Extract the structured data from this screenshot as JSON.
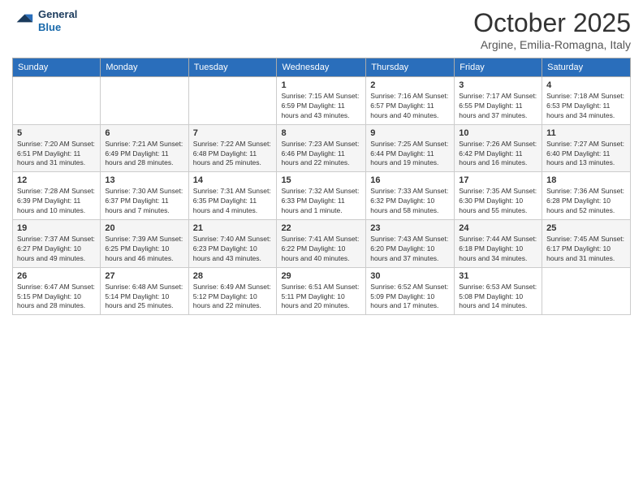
{
  "logo": {
    "line1": "General",
    "line2": "Blue"
  },
  "title": "October 2025",
  "subtitle": "Argine, Emilia-Romagna, Italy",
  "days_of_week": [
    "Sunday",
    "Monday",
    "Tuesday",
    "Wednesday",
    "Thursday",
    "Friday",
    "Saturday"
  ],
  "weeks": [
    [
      {
        "day": "",
        "info": ""
      },
      {
        "day": "",
        "info": ""
      },
      {
        "day": "",
        "info": ""
      },
      {
        "day": "1",
        "info": "Sunrise: 7:15 AM\nSunset: 6:59 PM\nDaylight: 11 hours\nand 43 minutes."
      },
      {
        "day": "2",
        "info": "Sunrise: 7:16 AM\nSunset: 6:57 PM\nDaylight: 11 hours\nand 40 minutes."
      },
      {
        "day": "3",
        "info": "Sunrise: 7:17 AM\nSunset: 6:55 PM\nDaylight: 11 hours\nand 37 minutes."
      },
      {
        "day": "4",
        "info": "Sunrise: 7:18 AM\nSunset: 6:53 PM\nDaylight: 11 hours\nand 34 minutes."
      }
    ],
    [
      {
        "day": "5",
        "info": "Sunrise: 7:20 AM\nSunset: 6:51 PM\nDaylight: 11 hours\nand 31 minutes."
      },
      {
        "day": "6",
        "info": "Sunrise: 7:21 AM\nSunset: 6:49 PM\nDaylight: 11 hours\nand 28 minutes."
      },
      {
        "day": "7",
        "info": "Sunrise: 7:22 AM\nSunset: 6:48 PM\nDaylight: 11 hours\nand 25 minutes."
      },
      {
        "day": "8",
        "info": "Sunrise: 7:23 AM\nSunset: 6:46 PM\nDaylight: 11 hours\nand 22 minutes."
      },
      {
        "day": "9",
        "info": "Sunrise: 7:25 AM\nSunset: 6:44 PM\nDaylight: 11 hours\nand 19 minutes."
      },
      {
        "day": "10",
        "info": "Sunrise: 7:26 AM\nSunset: 6:42 PM\nDaylight: 11 hours\nand 16 minutes."
      },
      {
        "day": "11",
        "info": "Sunrise: 7:27 AM\nSunset: 6:40 PM\nDaylight: 11 hours\nand 13 minutes."
      }
    ],
    [
      {
        "day": "12",
        "info": "Sunrise: 7:28 AM\nSunset: 6:39 PM\nDaylight: 11 hours\nand 10 minutes."
      },
      {
        "day": "13",
        "info": "Sunrise: 7:30 AM\nSunset: 6:37 PM\nDaylight: 11 hours\nand 7 minutes."
      },
      {
        "day": "14",
        "info": "Sunrise: 7:31 AM\nSunset: 6:35 PM\nDaylight: 11 hours\nand 4 minutes."
      },
      {
        "day": "15",
        "info": "Sunrise: 7:32 AM\nSunset: 6:33 PM\nDaylight: 11 hours\nand 1 minute."
      },
      {
        "day": "16",
        "info": "Sunrise: 7:33 AM\nSunset: 6:32 PM\nDaylight: 10 hours\nand 58 minutes."
      },
      {
        "day": "17",
        "info": "Sunrise: 7:35 AM\nSunset: 6:30 PM\nDaylight: 10 hours\nand 55 minutes."
      },
      {
        "day": "18",
        "info": "Sunrise: 7:36 AM\nSunset: 6:28 PM\nDaylight: 10 hours\nand 52 minutes."
      }
    ],
    [
      {
        "day": "19",
        "info": "Sunrise: 7:37 AM\nSunset: 6:27 PM\nDaylight: 10 hours\nand 49 minutes."
      },
      {
        "day": "20",
        "info": "Sunrise: 7:39 AM\nSunset: 6:25 PM\nDaylight: 10 hours\nand 46 minutes."
      },
      {
        "day": "21",
        "info": "Sunrise: 7:40 AM\nSunset: 6:23 PM\nDaylight: 10 hours\nand 43 minutes."
      },
      {
        "day": "22",
        "info": "Sunrise: 7:41 AM\nSunset: 6:22 PM\nDaylight: 10 hours\nand 40 minutes."
      },
      {
        "day": "23",
        "info": "Sunrise: 7:43 AM\nSunset: 6:20 PM\nDaylight: 10 hours\nand 37 minutes."
      },
      {
        "day": "24",
        "info": "Sunrise: 7:44 AM\nSunset: 6:18 PM\nDaylight: 10 hours\nand 34 minutes."
      },
      {
        "day": "25",
        "info": "Sunrise: 7:45 AM\nSunset: 6:17 PM\nDaylight: 10 hours\nand 31 minutes."
      }
    ],
    [
      {
        "day": "26",
        "info": "Sunrise: 6:47 AM\nSunset: 5:15 PM\nDaylight: 10 hours\nand 28 minutes."
      },
      {
        "day": "27",
        "info": "Sunrise: 6:48 AM\nSunset: 5:14 PM\nDaylight: 10 hours\nand 25 minutes."
      },
      {
        "day": "28",
        "info": "Sunrise: 6:49 AM\nSunset: 5:12 PM\nDaylight: 10 hours\nand 22 minutes."
      },
      {
        "day": "29",
        "info": "Sunrise: 6:51 AM\nSunset: 5:11 PM\nDaylight: 10 hours\nand 20 minutes."
      },
      {
        "day": "30",
        "info": "Sunrise: 6:52 AM\nSunset: 5:09 PM\nDaylight: 10 hours\nand 17 minutes."
      },
      {
        "day": "31",
        "info": "Sunrise: 6:53 AM\nSunset: 5:08 PM\nDaylight: 10 hours\nand 14 minutes."
      },
      {
        "day": "",
        "info": ""
      }
    ]
  ]
}
